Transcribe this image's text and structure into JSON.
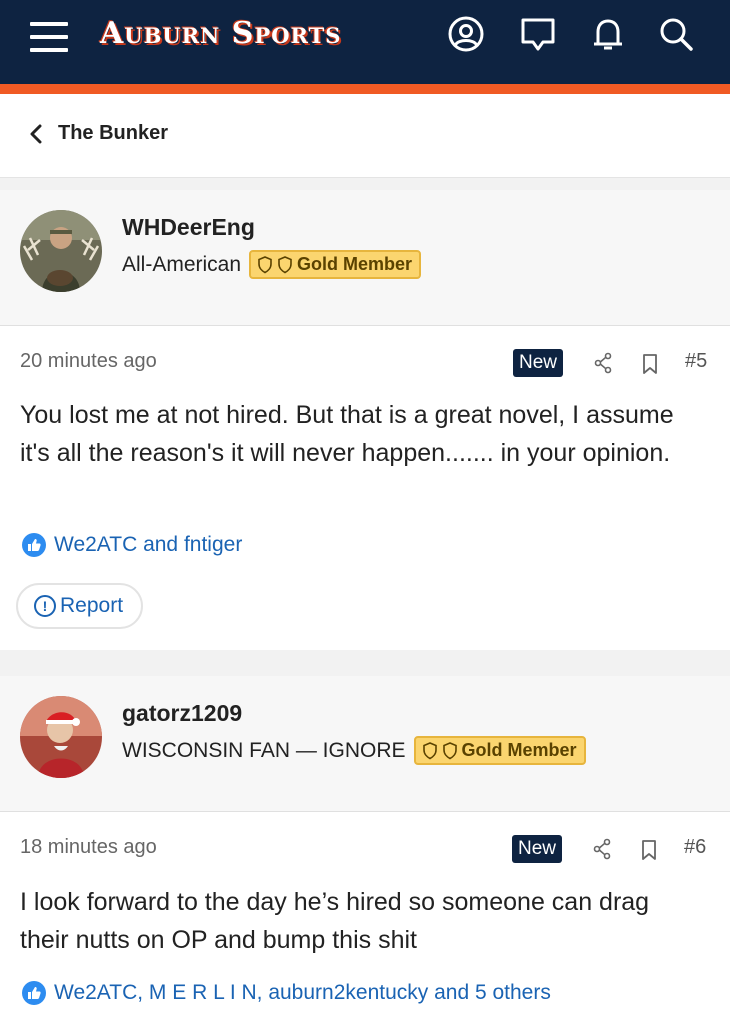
{
  "header": {
    "brand": "Auburn Sports",
    "menu_icon": "hamburger-menu-icon",
    "icons": [
      "account-icon",
      "messages-icon",
      "notifications-icon",
      "search-icon"
    ],
    "colors": {
      "navy": "#0e2341",
      "accent": "#f05a24"
    }
  },
  "breadcrumb": {
    "label": "The Bunker",
    "icon": "chevron-left-icon"
  },
  "posts": [
    {
      "username": "WHDeerEng",
      "title": "All-American",
      "badge": "Gold Member",
      "time": "20 minutes ago",
      "new_label": "New",
      "number": "#5",
      "text": "You lost me at not hired. But that is a great novel, I assume it's all the reason's it will never happen....... in your opinion.",
      "likes": "We2ATC and fntiger",
      "report": "Report"
    },
    {
      "username": "gatorz1209",
      "title": "WISCONSIN FAN — IGNORE",
      "badge": "Gold Member",
      "time": "18 minutes ago",
      "new_label": "New",
      "number": "#6",
      "text": "I look forward to the day he’s hired so someone can drag their nutts on OP and bump this shit",
      "likes": "We2ATC, M E R L I N, auburn2kentucky and 5 others"
    }
  ]
}
